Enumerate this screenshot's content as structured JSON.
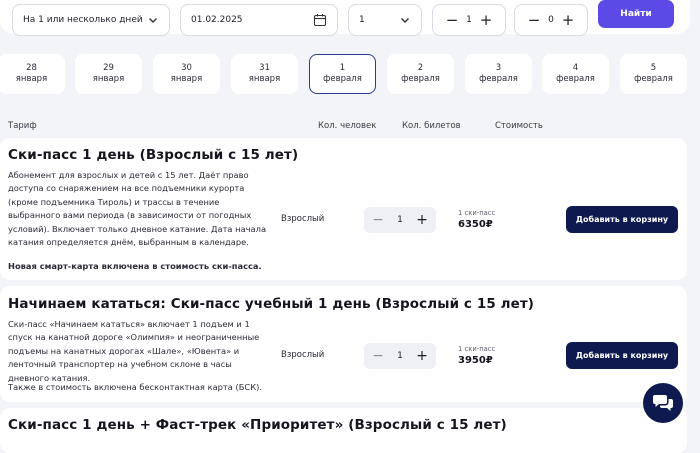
{
  "search": {
    "days_select": "На 1 или несколько дней",
    "date_value": "01.02.2025",
    "count_select": "1",
    "adults_value": "1",
    "children_value": "0",
    "minus_symbol": "−",
    "plus_symbol": "+",
    "search_button": "Найти"
  },
  "dates": [
    {
      "day": "28",
      "month": "января"
    },
    {
      "day": "29",
      "month": "января"
    },
    {
      "day": "30",
      "month": "января"
    },
    {
      "day": "31",
      "month": "января"
    },
    {
      "day": "1",
      "month": "февраля",
      "active": true
    },
    {
      "day": "2",
      "month": "февраля"
    },
    {
      "day": "3",
      "month": "февраля"
    },
    {
      "day": "4",
      "month": "февраля"
    },
    {
      "day": "5",
      "month": "февраля"
    }
  ],
  "table_header": {
    "tariff": "Тариф",
    "people": "Кол. человек",
    "tickets": "Кол. билетов",
    "price": "Стоимость"
  },
  "products": [
    {
      "title": "Ски-пасс 1 день (Взрослый с 15 лет)",
      "description": "Абонемент для взрослых и детей с 15 лет. Даёт право доступа со снаряжением на все подъемники курорта (кроме подъемника Тироль) и трассы в течение выбранного вами периода (в зависимости от погодных условий). Включает только дневное катание. Дата начала катания определяется днём, выбранным в календаре.",
      "note": "Новая смарт-карта включена в стоимость ски-пасса.",
      "age": "Взрослый",
      "quantity": "1",
      "price_label": "1 ски-пасс",
      "price": "6350₽",
      "cart_button": "Добавить в корзину"
    },
    {
      "title": "Начинаем кататься: Ски-пасс учебный 1 день (Взрослый с 15 лет)",
      "description": "Ски-пасс «Начинаем кататься» включает 1 подъем и 1 спуск на канатной дороге «Олимпия» и неограниченные подъемы на канатных дорогах «Шале», «Ювента» и ленточный транспортер на учебном склоне в часы дневного катания.",
      "note": "Также в стоимость включена бесконтактная карта (БСК).",
      "age": "Взрослый",
      "quantity": "1",
      "price_label": "1 ски-пасс",
      "price": "3950₽",
      "cart_button": "Добавить в корзину"
    },
    {
      "title": "Ски-пасс 1 день + Фаст-трек «Приоритет» (Взрослый с 15 лет)"
    }
  ],
  "icons": {
    "chevron": "chevron-down-icon",
    "calendar": "calendar-icon",
    "chat": "chat-icon"
  },
  "colors": {
    "accent": "#5b4ae6",
    "primary_dark": "#0e1a4f",
    "active_border": "#2b3a8f",
    "background": "#f3f4f7"
  }
}
